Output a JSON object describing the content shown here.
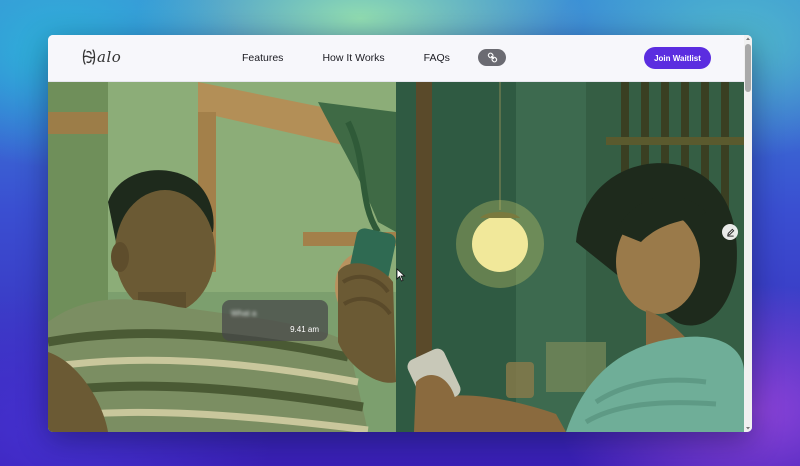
{
  "site": {
    "logo_text": "alo",
    "logo_icon": "swirl-h-logo"
  },
  "nav": {
    "links": [
      {
        "label": "Features"
      },
      {
        "label": "How It Works"
      },
      {
        "label": "FAQs"
      }
    ],
    "toggle_icon": "link-icon",
    "cta_label": "Join Waitlist"
  },
  "hero": {
    "message": {
      "preview": "What a",
      "time": "9.41 am"
    },
    "edit_icon": "pencil-icon"
  },
  "colors": {
    "accent": "#5b2de0",
    "photo_tint": "#5a8a5c"
  }
}
